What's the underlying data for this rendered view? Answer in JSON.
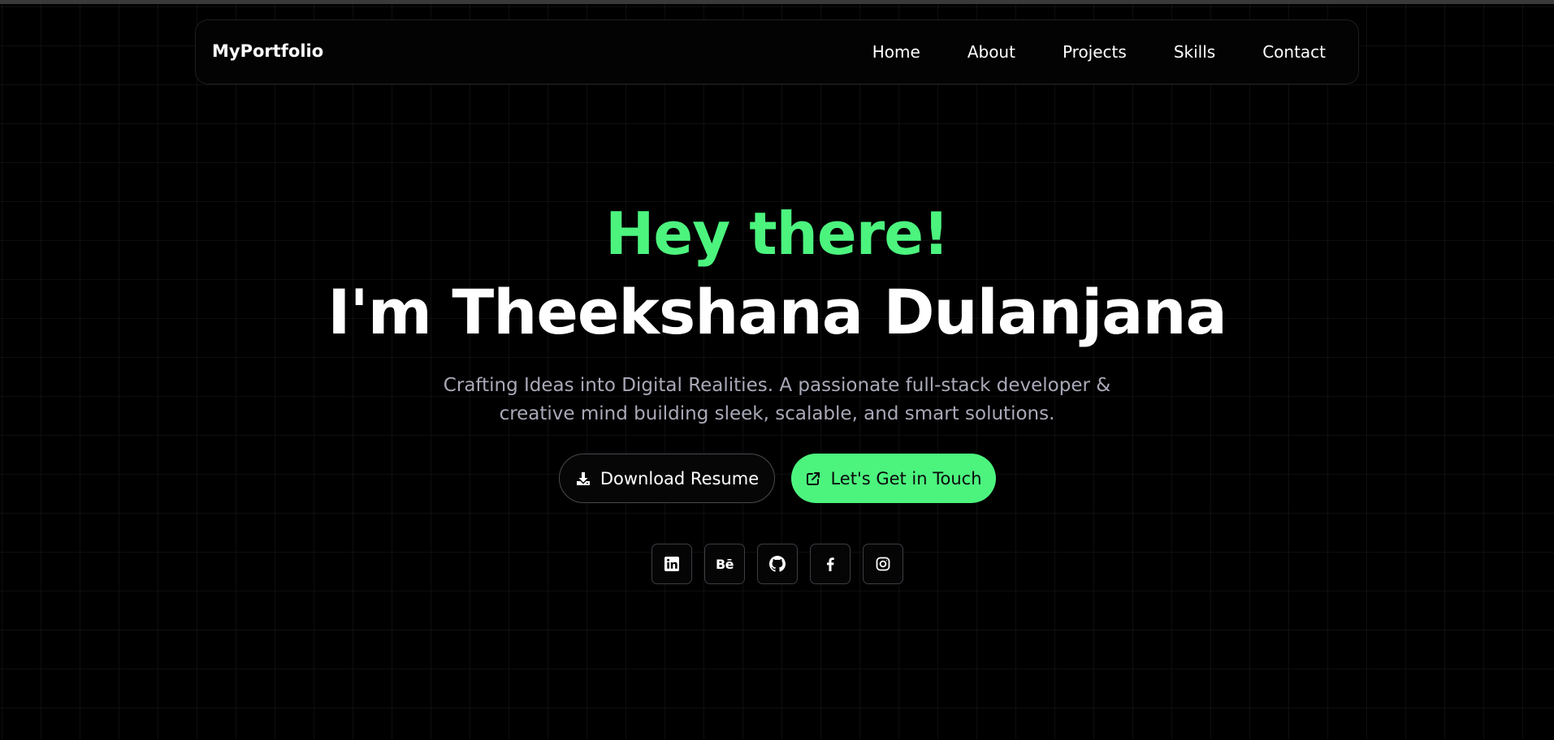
{
  "nav": {
    "brand": "MyPortfolio",
    "links": [
      "Home",
      "About",
      "Projects",
      "Skills",
      "Contact"
    ]
  },
  "hero": {
    "greeting": "Hey there!",
    "name": "I'm Theekshana Dulanjana",
    "tagline_line1": "Crafting Ideas into Digital Realities. A passionate full-stack developer &",
    "tagline_line2": "creative mind building sleek, scalable, and smart solutions."
  },
  "buttons": {
    "resume_label": "Download Resume",
    "resume_icon": "download-icon",
    "contact_label": "Let's Get in Touch",
    "contact_icon": "external-link-icon"
  },
  "socials": {
    "items": [
      {
        "icon": "linkedin-icon"
      },
      {
        "icon": "behance-icon",
        "text": "Bē"
      },
      {
        "icon": "github-icon"
      },
      {
        "icon": "facebook-icon"
      },
      {
        "icon": "instagram-icon"
      }
    ]
  },
  "colors": {
    "accent": "#4cf47e",
    "background": "#000000",
    "text": "#ffffff",
    "muted_text": "#a9a9b8"
  }
}
